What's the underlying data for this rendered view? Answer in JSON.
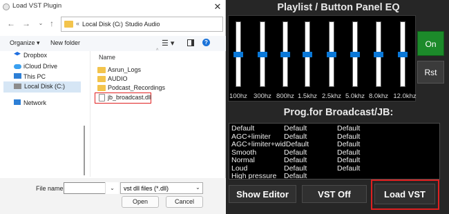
{
  "dialog": {
    "title": "Load VST Plugin",
    "close_glyph": "✕",
    "nav": {
      "back": "←",
      "forward": "→",
      "recent": "⌄",
      "up": "↑"
    },
    "address": {
      "sep": "«",
      "segment1": "Local Disk (C:)",
      "arrow": "›",
      "segment2": "Studio Audio"
    },
    "toolbar": {
      "organize": "Organize ▾",
      "new_folder": "New folder",
      "view_glyph": "☰ ▾",
      "help_glyph": "?"
    },
    "sidebar": {
      "dropbox": "Dropbox",
      "icloud": "iCloud Drive",
      "this_pc": "This PC",
      "local_disk": "Local Disk (C:)",
      "network": "Network"
    },
    "column_name": "Name",
    "sort_caret": "^",
    "files": [
      "Asrun_Logs",
      "AUDIO",
      "Podcast_Recordings",
      "jb_broadcast.dll"
    ],
    "file_name_label": "File name:",
    "file_name_value": "",
    "file_name_dropdown": "⌄",
    "filter_value": "vst dll files (*.dll)",
    "filter_caret": "⌄",
    "open_label": "Open",
    "cancel_label": "Cancel",
    "colors": {
      "folder": "#f3c44c",
      "selection": "#d6e6f5",
      "highlight": "#e02020"
    }
  },
  "eq": {
    "title": "Playlist / Button Panel EQ",
    "bands": [
      "100hz",
      "300hz",
      "800hz",
      "1.5khz",
      "2.5khz",
      "5.0khz",
      "8.0khz",
      "12.0khz"
    ],
    "on_label": "On",
    "reset_label": "Rst",
    "colors": {
      "on": "#1c8a2a",
      "thumb": "#0a78d8"
    }
  },
  "prog": {
    "title": "Prog.for Broadcast/JB:",
    "rows": [
      [
        "Default",
        "Default",
        "Default"
      ],
      [
        "AGC+limiter",
        "Default",
        "Default"
      ],
      [
        "AGC+limiter+widDefault",
        "",
        "Default"
      ],
      [
        "Smooth",
        "Default",
        "Default"
      ],
      [
        "Normal",
        "Default",
        "Default"
      ],
      [
        "Loud",
        "Default",
        "Default"
      ],
      [
        "High pressure",
        "Default",
        ""
      ]
    ]
  },
  "buttons": {
    "show_editor": "Show Editor",
    "vst_off": "VST Off",
    "load_vst": "Load VST"
  }
}
